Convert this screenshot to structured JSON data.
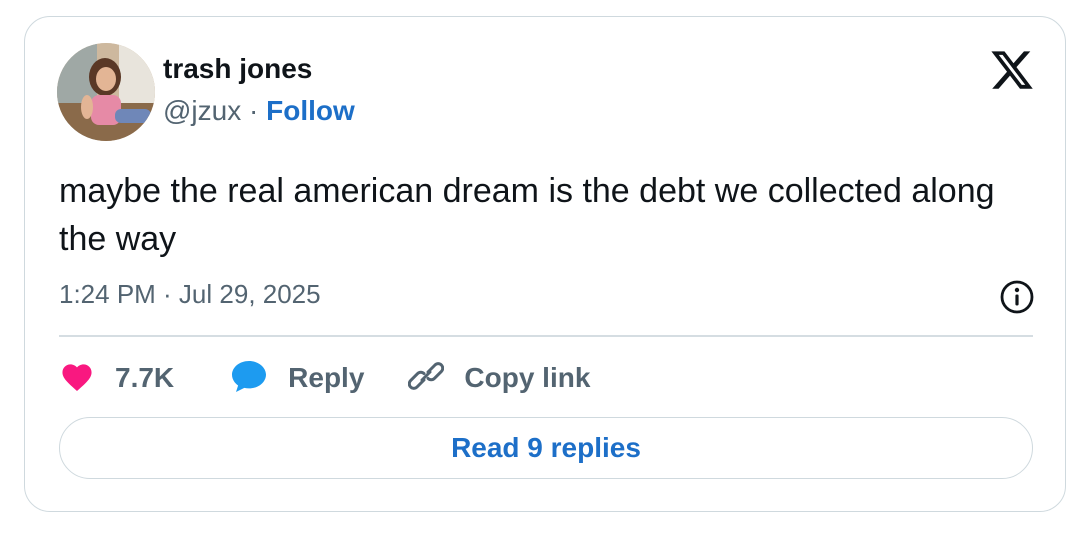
{
  "tweet": {
    "author": {
      "display_name": "trash jones",
      "handle": "@jzux",
      "separator": " · ",
      "follow_label": "Follow"
    },
    "platform_icon": "x-logo-icon",
    "text": "maybe the real american dream is the debt we collected along the way",
    "timestamp": "1:24 PM · Jul 29, 2025",
    "info_icon": "info-icon",
    "actions": {
      "like_count": "7.7K",
      "reply_label": "Reply",
      "copy_label": "Copy link"
    },
    "read_replies_label": "Read 9 replies"
  },
  "colors": {
    "like": "#f91880",
    "reply": "#1d9bf0",
    "link": "#1d6fc8",
    "muted": "#536471",
    "text": "#0f1419",
    "border": "#cfd9de"
  }
}
